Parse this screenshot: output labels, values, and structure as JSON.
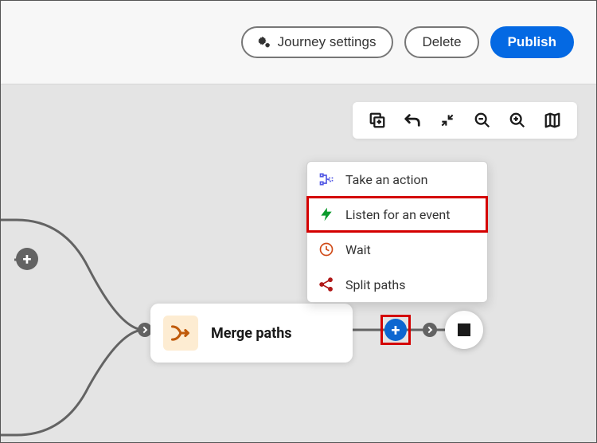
{
  "header": {
    "journey_settings_label": "Journey settings",
    "delete_label": "Delete",
    "publish_label": "Publish"
  },
  "toolbar": {
    "copy_icon": "copy",
    "undo_icon": "undo",
    "collapse_icon": "collapse",
    "zoom_out_icon": "zoom-out",
    "zoom_in_icon": "zoom-in",
    "minimap_icon": "minimap"
  },
  "node": {
    "title": "Merge paths"
  },
  "popover_menu": {
    "items": [
      {
        "label": "Take an action",
        "icon": "action"
      },
      {
        "label": "Listen for an event",
        "icon": "event",
        "highlighted": true
      },
      {
        "label": "Wait",
        "icon": "wait"
      },
      {
        "label": "Split paths",
        "icon": "split"
      }
    ]
  }
}
